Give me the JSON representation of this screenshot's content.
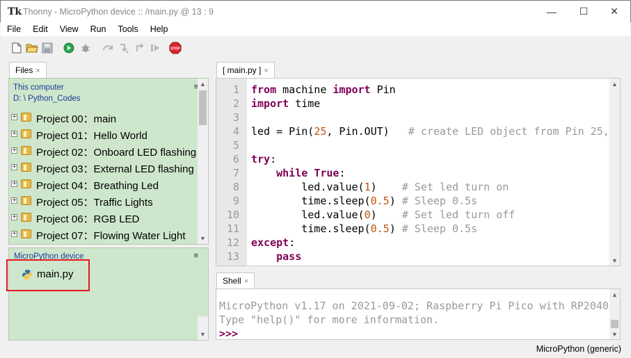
{
  "window": {
    "title": "Thonny  -  MicroPython device :: /main.py  @  13 : 9",
    "app_icon": "Tk",
    "minimize": "—",
    "maximize": "☐",
    "close": "✕"
  },
  "menu": [
    "File",
    "Edit",
    "View",
    "Run",
    "Tools",
    "Help"
  ],
  "toolbar": {
    "icons": [
      "new-file-icon",
      "open-folder-icon",
      "save-icon",
      "run-icon",
      "debug-icon",
      "step-over-icon",
      "step-into-icon",
      "step-out-icon",
      "resume-icon",
      "stop-icon"
    ],
    "stop_label": "STOP"
  },
  "files": {
    "tab_label": "Files",
    "tab_close": "×",
    "computer_header": "This computer",
    "computer_path": "D: \\ Python_Codes",
    "menu_glyph": "≡",
    "projects": [
      "Project 00：main",
      "Project 01：Hello World",
      "Project 02：Onboard LED flashing",
      "Project 03：External LED flashing",
      "Project 04：Breathing Led",
      "Project 05：Traffic Lights",
      "Project 06：RGB LED",
      "Project 07：Flowing Water Light"
    ],
    "expander": "+",
    "device_header": "MicroPython device",
    "device_file": "main.py"
  },
  "editor": {
    "tab_label": "[ main.py ]",
    "tab_close": "×",
    "line_numbers": [
      "1",
      "2",
      "3",
      "4",
      "5",
      "6",
      "7",
      "8",
      "9",
      "10",
      "11",
      "12",
      "13"
    ]
  },
  "shell": {
    "tab_label": "Shell",
    "tab_close": "×",
    "line1": "MicroPython v1.17 on 2021-09-02; Raspberry Pi Pico with RP2040",
    "line2": "Type \"help()\" for more information.",
    "prompt": ">>>"
  },
  "status": {
    "interpreter": "MicroPython (generic)"
  },
  "colors": {
    "files_bg": "#cee7cc",
    "keyword": "#7f0055",
    "number": "#b8540c",
    "comment": "#999999",
    "highlight_box": "#e8141d"
  }
}
